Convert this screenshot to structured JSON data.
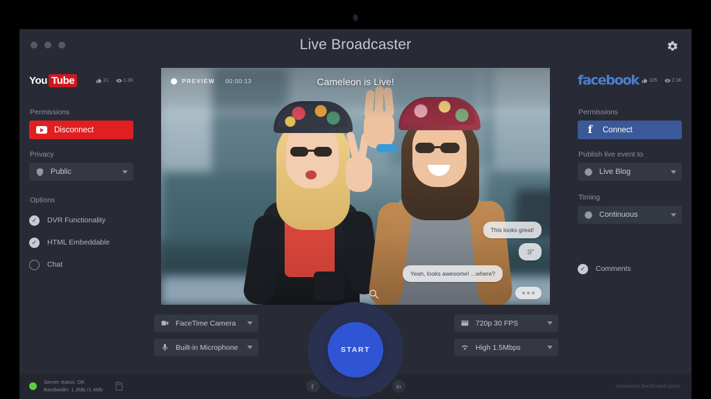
{
  "window": {
    "title": "Live Broadcaster",
    "traffic_lights": [
      "close",
      "minimize",
      "maximize"
    ],
    "settings_icon": "gear-icon"
  },
  "left_panel": {
    "brand": {
      "name": "YouTube",
      "part1": "You",
      "part2": "Tube"
    },
    "stats": {
      "likes": "21",
      "views": "1.3K"
    },
    "permissions_label": "Permissions",
    "connect_button": {
      "label": "Disconnect",
      "state": "connected",
      "color": "#e02020",
      "icon": "youtube-play-icon"
    },
    "privacy_label": "Privacy",
    "privacy_value": "Public",
    "privacy_icon": "shield-icon",
    "options_label": "Options",
    "options": [
      {
        "label": "DVR Functionality",
        "checked": true
      },
      {
        "label": "HTML Embeddable",
        "checked": true
      },
      {
        "label": "Chat",
        "checked": false
      }
    ]
  },
  "right_panel": {
    "brand": {
      "name": "facebook"
    },
    "stats": {
      "likes": "105",
      "views": "2.3K"
    },
    "permissions_label": "Permissions",
    "connect_button": {
      "label": "Connect",
      "state": "disconnected",
      "color": "#3b5998",
      "icon": "facebook-f-icon"
    },
    "publish_label": "Publish live event to",
    "publish_value": "Live Blog",
    "publish_icon": "user-circle-icon",
    "timing_label": "Timing",
    "timing_value": "Continuous",
    "timing_icon": "clock-icon",
    "options": [
      {
        "label": "Comments",
        "checked": true
      }
    ]
  },
  "video": {
    "preview_label": "PREVIEW",
    "timecode": "00:00:13",
    "overlay_title": "Cameleon is Live!",
    "zoom_icon": "magnifier-icon",
    "chat": [
      {
        "text": "This looks great!",
        "side": "right"
      },
      {
        "text": ":))''",
        "side": "right"
      },
      {
        "text": "Yeah, looks awesome! ...where?",
        "side": "left"
      }
    ],
    "typing_indicator": "•••"
  },
  "controls": {
    "camera": {
      "value": "FaceTime Camera",
      "icon": "video-camera-icon"
    },
    "microphone": {
      "value": "Built-in Microphone",
      "icon": "microphone-icon"
    },
    "quality": {
      "value": "720p 30 FPS",
      "icon": "film-icon"
    },
    "bandwidth": {
      "value": "High 1.5Mbps",
      "icon": "wifi-icon"
    },
    "start_button": {
      "label": "START",
      "color": "#2f55d4"
    }
  },
  "statusbar": {
    "indicator_color": "#56d13d",
    "server_status": "Server status: OK",
    "bandwidth": "Bandwidth: 1.2Mb /1.4Mb",
    "card_icon": "sd-card-icon",
    "social": [
      "facebook-icon",
      "google-plus-icon",
      "twitter-icon",
      "email-icon",
      "linkedin-icon"
    ],
    "url": "cameleon.live/broadcaster"
  }
}
